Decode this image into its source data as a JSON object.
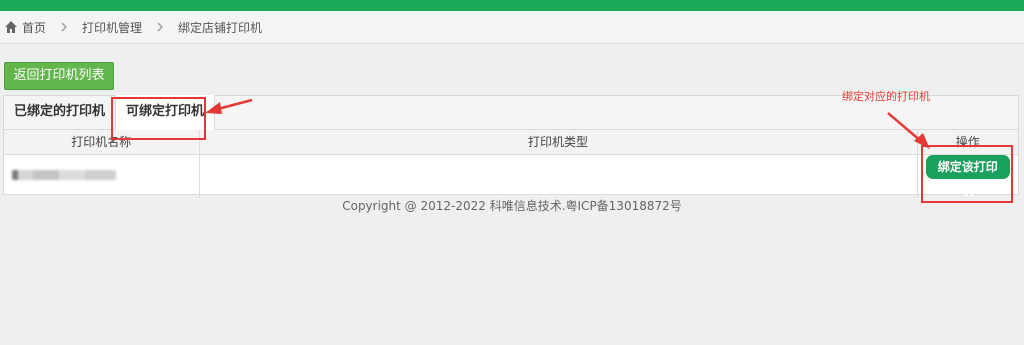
{
  "breadcrumb": {
    "items": [
      "首页",
      "打印机管理",
      "绑定店铺打印机"
    ]
  },
  "back_button": {
    "label": "返回打印机列表"
  },
  "tabs": [
    {
      "label": "已绑定的打印机",
      "active": false
    },
    {
      "label": "可绑定打印机",
      "active": true
    }
  ],
  "table": {
    "headers": [
      "打印机名称",
      "打印机类型",
      "操作"
    ],
    "rows": [
      {
        "name": "",
        "type": "",
        "action": "绑定该打印机"
      }
    ]
  },
  "footer": {
    "text": "Copyright @ 2012-2022 科唯信息技术.粤ICP备13018872号"
  },
  "annotation": {
    "text": "绑定对应的打印机"
  },
  "colors": {
    "top_bar": "#1ba85a",
    "back_button": "#62b64b",
    "action_button": "#1aa15d",
    "annotation": "#e53935"
  },
  "icons": {
    "home": "home-icon",
    "separator": "chevron-right-icon"
  }
}
